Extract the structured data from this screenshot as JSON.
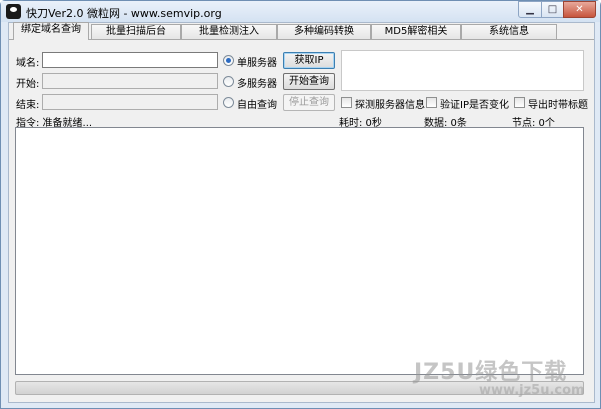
{
  "window": {
    "title": "快刀Ver2.0   微粒网 - www.semvip.org",
    "min_glyph": "▁",
    "max_glyph": "□",
    "close_glyph": "✕"
  },
  "tabs": [
    {
      "label": "绑定域名查询",
      "active": true
    },
    {
      "label": "批量扫描后台",
      "active": false
    },
    {
      "label": "批量检测注入",
      "active": false
    },
    {
      "label": "多种编码转换",
      "active": false
    },
    {
      "label": "MD5解密相关",
      "active": false
    },
    {
      "label": "系统信息",
      "active": false
    }
  ],
  "form": {
    "domain_label": "域名:",
    "domain_value": "",
    "start_label": "开始:",
    "start_value": "",
    "end_label": "结束:",
    "end_value": ""
  },
  "modes": {
    "single": {
      "label": "单服务器",
      "checked": true
    },
    "multi": {
      "label": "多服务器",
      "checked": false
    },
    "free": {
      "label": "自由查询",
      "checked": false
    }
  },
  "buttons": {
    "get_ip": "获取IP",
    "start_query": "开始查询",
    "stop_query": "停止查询"
  },
  "options": {
    "probe_server": "探测服务器信息",
    "verify_ip": "验证IP是否变化",
    "export_title": "导出时带标题"
  },
  "status": {
    "command": "指令: 准备就绪...",
    "elapsed": "耗时: 0秒",
    "count": "数据: 0条",
    "nodes": "节点: 0个"
  },
  "watermark": {
    "logo": "JZ5U绿色下载",
    "url": "www.jz5u.com"
  }
}
